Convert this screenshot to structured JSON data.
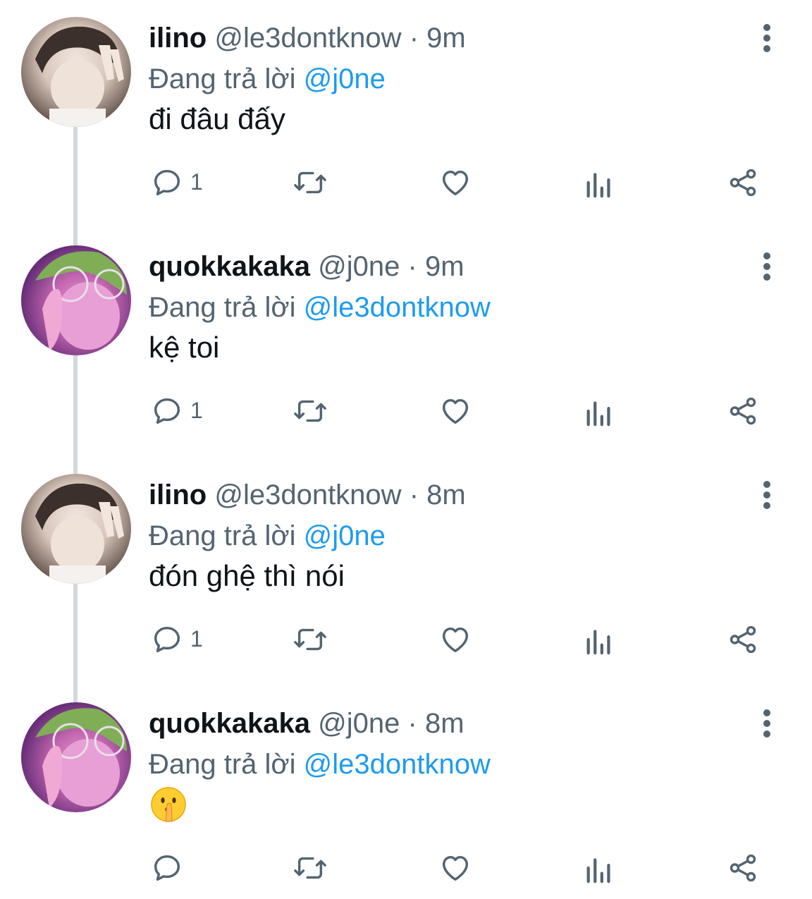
{
  "colors": {
    "text": "#0f1419",
    "secondary": "#536471",
    "mention": "#1d9bf0",
    "thread_line": "#cfd9de"
  },
  "tweets": [
    {
      "name": "ilino",
      "handle": "@le3dontknow",
      "separator": "·",
      "time": "9m",
      "replying_prefix": "Đang trả lời",
      "replying_to": "@j0ne",
      "text": "đi đâu đấy",
      "reply_count": "1",
      "avatar": "avatar-ilino"
    },
    {
      "name": "quokkakaka",
      "handle": "@j0ne",
      "separator": "·",
      "time": "9m",
      "replying_prefix": "Đang trả lời",
      "replying_to": "@le3dontknow",
      "text": "kệ toi",
      "reply_count": "1",
      "avatar": "avatar-quokkakaka"
    },
    {
      "name": "ilino",
      "handle": "@le3dontknow",
      "separator": "·",
      "time": "8m",
      "replying_prefix": "Đang trả lời",
      "replying_to": "@j0ne",
      "text": "đón ghệ thì nói",
      "reply_count": "1",
      "avatar": "avatar-ilino"
    },
    {
      "name": "quokkakaka",
      "handle": "@j0ne",
      "separator": "·",
      "time": "8m",
      "replying_prefix": "Đang trả lời",
      "replying_to": "@le3dontknow",
      "text": "",
      "emoji": "shushing-face-emoji",
      "reply_count": "",
      "avatar": "avatar-quokkakaka"
    }
  ],
  "icons": {
    "reply": "reply-icon",
    "retweet": "retweet-icon",
    "like": "heart-icon",
    "views": "views-icon",
    "share": "share-icon",
    "more": "more-vertical-icon"
  }
}
